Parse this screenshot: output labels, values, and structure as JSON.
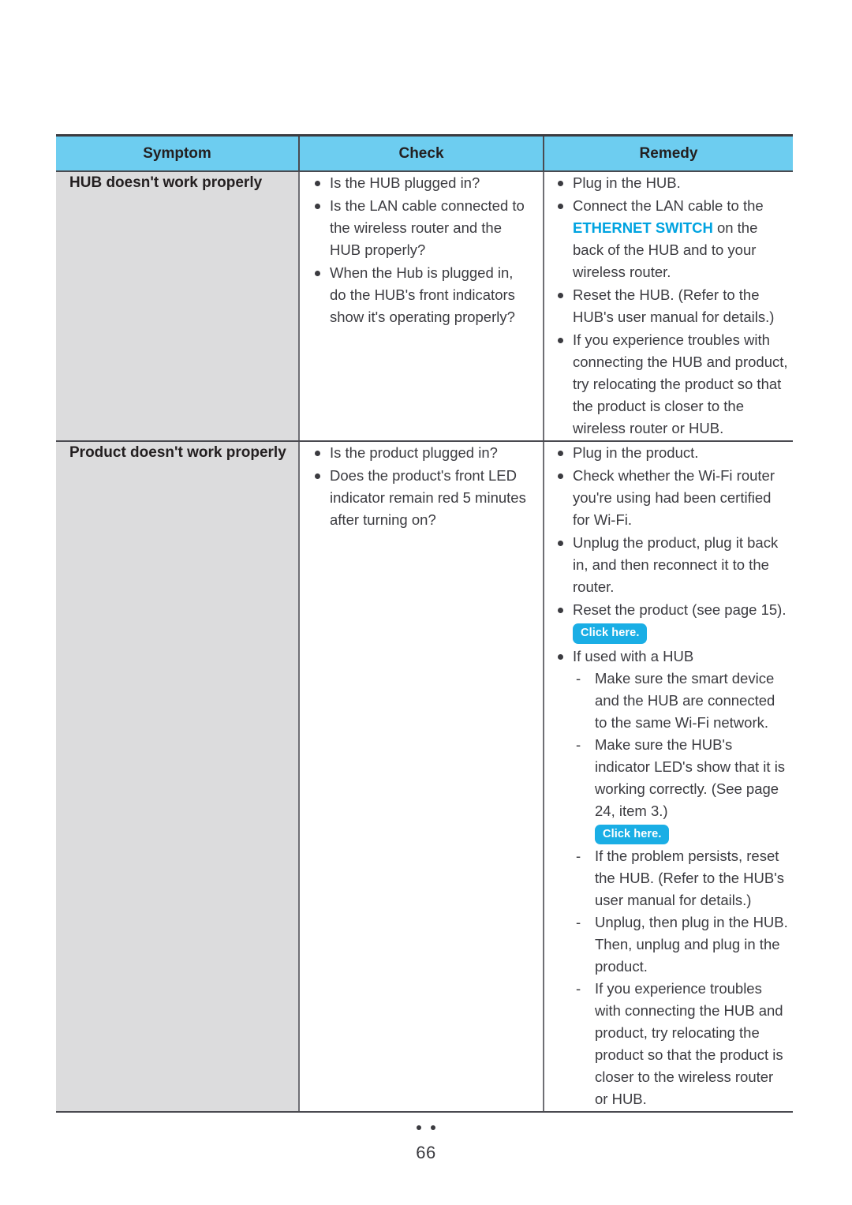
{
  "document": {
    "page_number": "66",
    "footer_dots": 2
  },
  "colors": {
    "header_bg": "#6dcdf0",
    "symptom_bg": "#dcdcdd",
    "keyword_blue": "#00a3e0",
    "badge_blue": "#1aaee5",
    "text": "#3b3b40",
    "border": "#4a4a50"
  },
  "table": {
    "headers": {
      "symptom": "Symptom",
      "check": "Check",
      "remedy": "Remedy"
    },
    "rows": [
      {
        "symptom": "HUB doesn't work properly",
        "check": [
          "Is the HUB plugged in?",
          "Is the LAN cable connected to the wireless router and the HUB properly?",
          "When the Hub is plugged in, do the HUB's front indicators show it's operating properly?"
        ],
        "remedy": [
          {
            "text": "Plug in the HUB."
          },
          {
            "pre": "Connect the LAN cable to the ",
            "keyword": "ETHERNET SWITCH",
            "post": " on the back of the HUB and to your wireless router."
          },
          {
            "text": "Reset the HUB. (Refer to the HUB's user manual for details.)"
          },
          {
            "text": "If you experience troubles with connecting the HUB and product, try relocating the product so that the product is closer to the wireless router or HUB."
          }
        ]
      },
      {
        "symptom": "Product doesn't work properly",
        "check": [
          "Is the product plugged in?",
          "Does the product's front LED indicator remain red 5 minutes after turning on?"
        ],
        "remedy": [
          {
            "text": "Plug in the product."
          },
          {
            "text": "Check whether the Wi-Fi router you're using had been certified for Wi-Fi."
          },
          {
            "text": "Unplug the product, plug it back in, and then reconnect it to the router."
          },
          {
            "text": "Reset the product (see page 15).",
            "badge": "Click here."
          },
          {
            "text": "If used with a HUB",
            "sub": [
              {
                "text": "Make sure the smart device and the HUB are connected to the same Wi-Fi network."
              },
              {
                "text": "Make sure the HUB's indicator LED's show that it is working correctly. (See page 24, item 3.)",
                "badge": "Click here."
              },
              {
                "text": "If the problem persists, reset the HUB. (Refer to the HUB's user manual for details.)"
              },
              {
                "text": "Unplug, then plug in the HUB. Then, unplug and plug in the product."
              },
              {
                "text": "If you experience troubles with connecting the HUB and product, try relocating the product so that the product is closer to the wireless router or HUB."
              }
            ]
          }
        ]
      }
    ]
  }
}
